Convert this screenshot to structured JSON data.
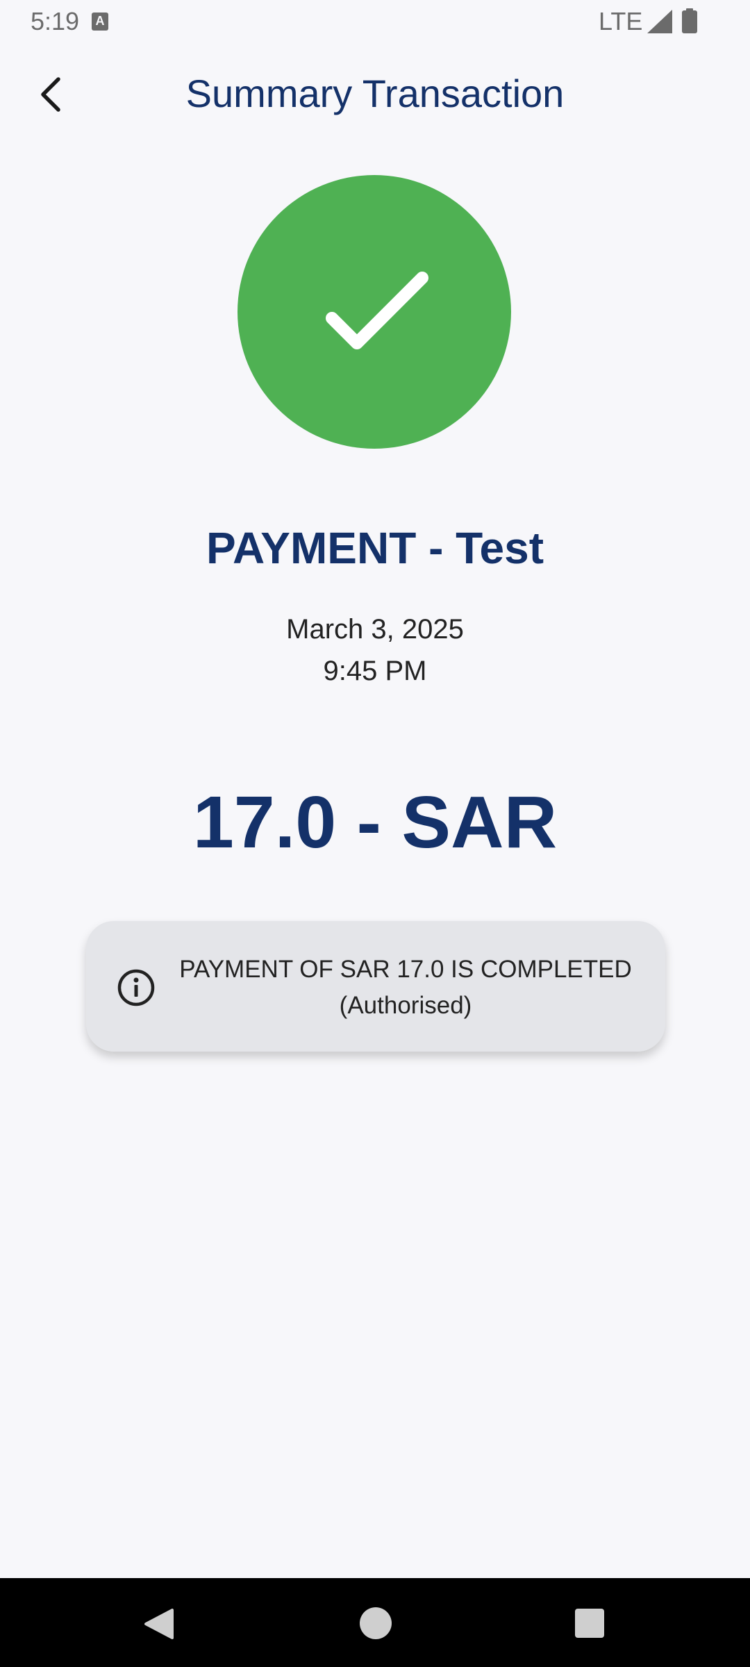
{
  "status_bar": {
    "time": "5:19",
    "notification_icon_letter": "A",
    "network": "LTE"
  },
  "header": {
    "title": "Summary Transaction",
    "back_icon": "chevron-left-icon"
  },
  "transaction": {
    "status_icon": "check-icon",
    "status_color": "#4fb153",
    "title": "PAYMENT - Test",
    "date": "March 3, 2025",
    "time": "9:45 PM",
    "amount": "17.0 - SAR",
    "message_line1": "PAYMENT OF SAR 17.0 IS COMPLETED",
    "message_line2": "(Authorised)"
  },
  "colors": {
    "primary_text": "#143169",
    "background": "#f7f7fa",
    "card_background": "#e4e5e9"
  }
}
